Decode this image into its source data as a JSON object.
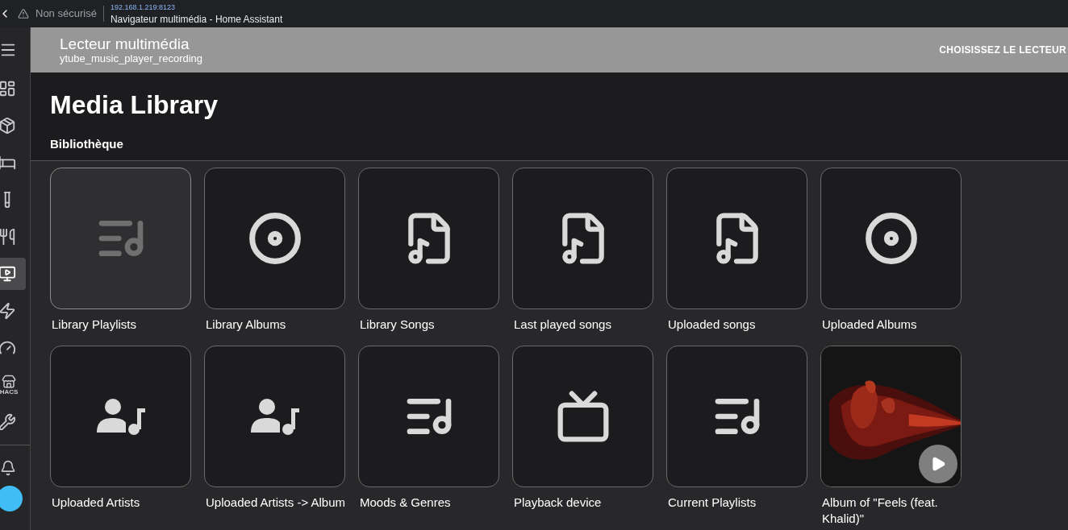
{
  "browser": {
    "security": "Non sécurisé",
    "address": "192.168.1.219:8123",
    "tab_title": "Navigateur multimédia - Home Assistant"
  },
  "sidebar": {
    "items": [
      {
        "kind": "dashboard",
        "selected": false
      },
      {
        "kind": "package",
        "selected": false
      },
      {
        "kind": "bed",
        "selected": false
      },
      {
        "kind": "flask",
        "selected": false
      },
      {
        "kind": "food",
        "selected": false
      },
      {
        "kind": "media",
        "selected": true
      },
      {
        "kind": "energy",
        "selected": false
      },
      {
        "kind": "gauge",
        "selected": false
      },
      {
        "kind": "store",
        "selected": false
      },
      {
        "kind": "wrench",
        "selected": false
      }
    ],
    "store_label": "HACS"
  },
  "header": {
    "title": "Lecteur multimédia",
    "subtitle": "ytube_music_player_recording",
    "action": "CHOISISSEZ LE LECTEUR"
  },
  "library": {
    "title": "Media Library",
    "subtitle": "Bibliothèque"
  },
  "tiles": [
    {
      "kind": "playlist",
      "label": "Library Playlists",
      "hovered": true
    },
    {
      "kind": "album",
      "label": "Library Albums",
      "hovered": false
    },
    {
      "kind": "song",
      "label": "Library Songs",
      "hovered": false
    },
    {
      "kind": "song",
      "label": "Last played songs",
      "hovered": false
    },
    {
      "kind": "song",
      "label": "Uploaded songs",
      "hovered": false
    },
    {
      "kind": "album",
      "label": "Uploaded Albums",
      "hovered": false
    },
    {
      "kind": "artist",
      "label": "Uploaded Artists",
      "hovered": false
    },
    {
      "kind": "artist",
      "label": "Uploaded Artists -> Album",
      "hovered": false
    },
    {
      "kind": "playlist",
      "label": "Moods & Genres",
      "hovered": false
    },
    {
      "kind": "tv",
      "label": "Playback device",
      "hovered": false
    },
    {
      "kind": "playlist",
      "label": "Current Playlists",
      "hovered": false
    },
    {
      "kind": "picture",
      "label": "Album of \"Feels (feat. Khalid)\"",
      "hovered": false
    }
  ]
}
